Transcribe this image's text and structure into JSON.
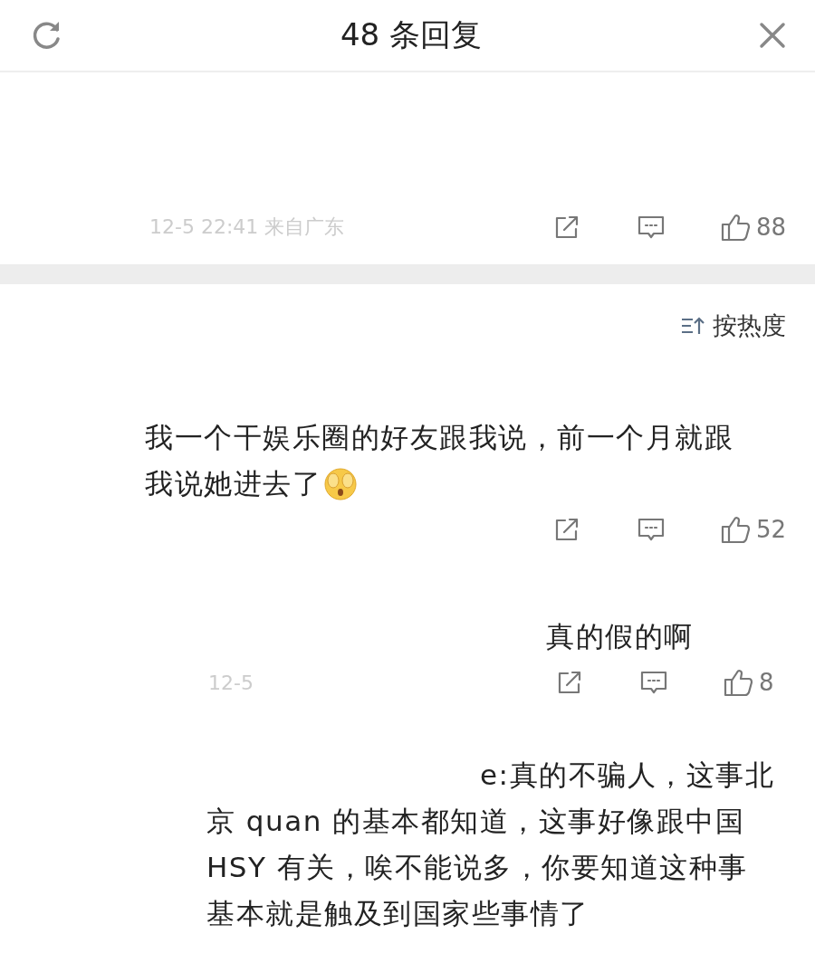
{
  "header": {
    "title": "48 条回复"
  },
  "top_comment": {
    "meta": "12-5 22:41 来自广东",
    "likes": "88"
  },
  "sort": {
    "label": "按热度"
  },
  "comments": [
    {
      "kind": "comment",
      "lines": [
        "我一个干娱乐圈的好友跟我说，前一个月就跟",
        "我说她进去了"
      ],
      "emoji": true,
      "likes": "52"
    },
    {
      "kind": "reply",
      "lines": [
        "真的假的啊"
      ],
      "meta": "12-5",
      "likes": "8"
    },
    {
      "kind": "long-reply",
      "lines": [
        "e:真的不骗人，这事北",
        "京 quan 的基本都知道，这事好像跟中国",
        "HSY 有关，唉不能说多，你要知道这种事",
        "基本就是触及到国家些事情了"
      ]
    }
  ]
}
